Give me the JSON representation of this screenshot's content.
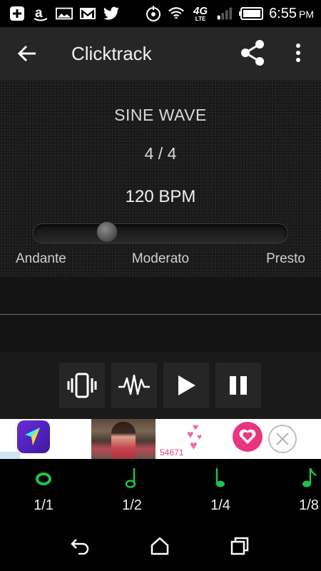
{
  "status_bar": {
    "time": "6:55",
    "ampm": "PM",
    "icons": [
      "add-icon",
      "amazon-icon",
      "image-icon",
      "gmail-icon",
      "twitter-icon",
      "nfc-icon",
      "wifi-icon",
      "4g-lte-icon",
      "signal-icon",
      "battery-icon"
    ],
    "network_label": "4G",
    "network_sublabel": "LTE"
  },
  "app_bar": {
    "title": "Clicktrack",
    "icons": [
      "back-arrow-icon",
      "share-icon",
      "more-vert-icon"
    ]
  },
  "metronome": {
    "sound": "SINE WAVE",
    "time_signature": "4 / 4",
    "tempo": "120 BPM",
    "slider_fraction": 0.27,
    "tempo_marks": [
      "Andante",
      "Moderato",
      "Presto"
    ]
  },
  "controls": {
    "buttons": [
      "vibrate-icon",
      "waveform-icon",
      "play-icon",
      "pause-icon"
    ]
  },
  "ad": {
    "count": "54671"
  },
  "subdivisions": {
    "items": [
      {
        "label": "1/1",
        "icon": "whole-note-icon"
      },
      {
        "label": "1/2",
        "icon": "half-note-icon"
      },
      {
        "label": "1/4",
        "icon": "quarter-note-icon"
      },
      {
        "label": "1/8",
        "icon": "eighth-note-icon"
      }
    ],
    "accent_color": "#1fc24a"
  },
  "nav_bar": {
    "icons": [
      "nav-back-icon",
      "nav-home-icon",
      "nav-recents-icon"
    ]
  }
}
